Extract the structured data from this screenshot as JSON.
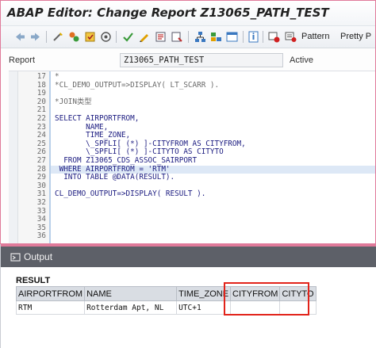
{
  "editor": {
    "title": "ABAP Editor: Change Report Z13065_PATH_TEST",
    "toolbar": {
      "icons": [
        "back-arrow-icon",
        "forward-arrow-icon",
        "other-object-icon",
        "change-display-icon",
        "active-inactive-icon",
        "check-icon",
        "activate-icon",
        "test-icon",
        "where-used-icon",
        "edit-pencil-icon",
        "display-object-list-icon",
        "set-breakpoint-icon",
        "hierarchy-icon",
        "navigation-window-icon",
        "help-info-icon",
        "pattern-icon",
        "pretty-printer-icon"
      ],
      "pattern_label": "Pattern",
      "pretty_printer_label": "Pretty P"
    },
    "report": {
      "label": "Report",
      "value": "Z13065_PATH_TEST",
      "status": "Active"
    },
    "code_lines": [
      {
        "num": "17",
        "text": "*"
      },
      {
        "num": "18",
        "text": "*CL_DEMO_OUTPUT=>DISPLAY( LT_SCARR )."
      },
      {
        "num": "19",
        "text": ""
      },
      {
        "num": "20",
        "text": "*JOIN类型"
      },
      {
        "num": "21",
        "text": ""
      },
      {
        "num": "22",
        "text": "SELECT AIRPORTFROM,"
      },
      {
        "num": "23",
        "text": "       NAME,"
      },
      {
        "num": "24",
        "text": "       TIME_ZONE,"
      },
      {
        "num": "25",
        "text": "       \\_SPFLI[ (*) ]-CITYFROM AS CITYFROM,"
      },
      {
        "num": "26",
        "text": "       \\_SPFLI[ (*) ]-CITYTO AS CITYTO"
      },
      {
        "num": "27",
        "text": "  FROM Z13065_CDS_ASSOC_SAIRPORT"
      },
      {
        "num": "28",
        "text": " WHERE AIRPORTFROM = 'RTM'"
      },
      {
        "num": "29",
        "text": "  INTO TABLE @DATA(RESULT)."
      },
      {
        "num": "30",
        "text": ""
      },
      {
        "num": "31",
        "text": "CL_DEMO_OUTPUT=>DISPLAY( RESULT )."
      },
      {
        "num": "32",
        "text": ""
      },
      {
        "num": "33",
        "text": ""
      },
      {
        "num": "34",
        "text": ""
      },
      {
        "num": "35",
        "text": ""
      },
      {
        "num": "36",
        "text": ""
      }
    ]
  },
  "output": {
    "title": "Output",
    "result_label": "RESULT",
    "columns": [
      "AIRPORTFROM",
      "NAME",
      "TIME_ZONE",
      "CITYFROM",
      "CITYTO"
    ],
    "rows": [
      [
        "RTM",
        "Rotterdam Apt, NL",
        "UTC+1",
        "",
        ""
      ]
    ]
  },
  "colors": {
    "highlight": "#e2231a",
    "output_header": "#5d6068",
    "window_border": "#e07a9a"
  }
}
